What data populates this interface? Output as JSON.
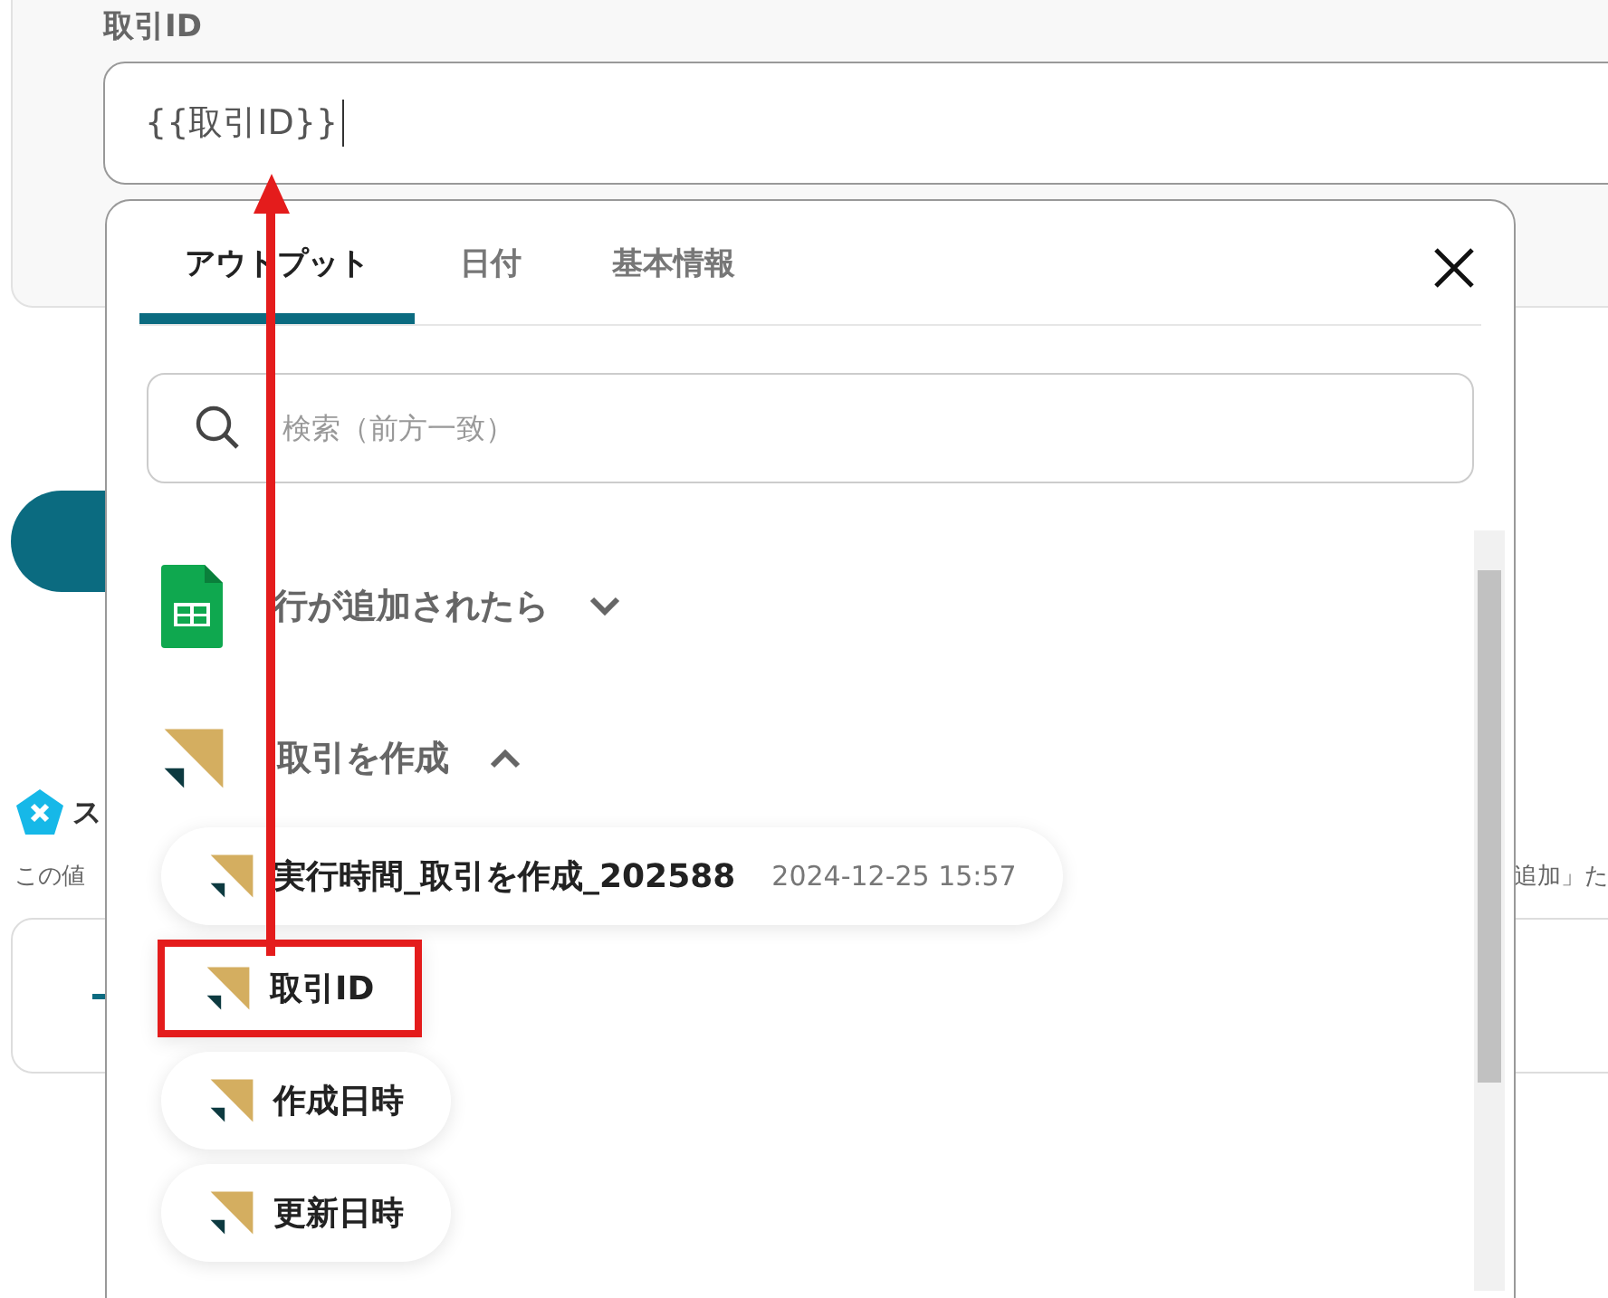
{
  "field": {
    "label": "取引ID",
    "value": "{{取引ID}}"
  },
  "background": {
    "heading": "ス",
    "note_start": "この値",
    "note_end": "追加」た"
  },
  "popup": {
    "tabs": [
      {
        "label": "アウトプット",
        "selected": true
      },
      {
        "label": "日付",
        "selected": false
      },
      {
        "label": "基本情報",
        "selected": false
      }
    ],
    "search": {
      "placeholder": "検索（前方一致）"
    },
    "groups": [
      {
        "title": "行が追加されたら",
        "kind": "sheets",
        "expanded": false
      },
      {
        "title": "取引を作成",
        "kind": "freee",
        "expanded": true,
        "items": [
          {
            "label": "実行時間_取引を作成_202588",
            "value": "2024-12-25 15:57",
            "highlighted": false
          },
          {
            "label": "取引ID",
            "highlighted": true
          },
          {
            "label": "作成日時",
            "highlighted": false
          },
          {
            "label": "更新日時",
            "highlighted": false
          }
        ]
      }
    ]
  }
}
